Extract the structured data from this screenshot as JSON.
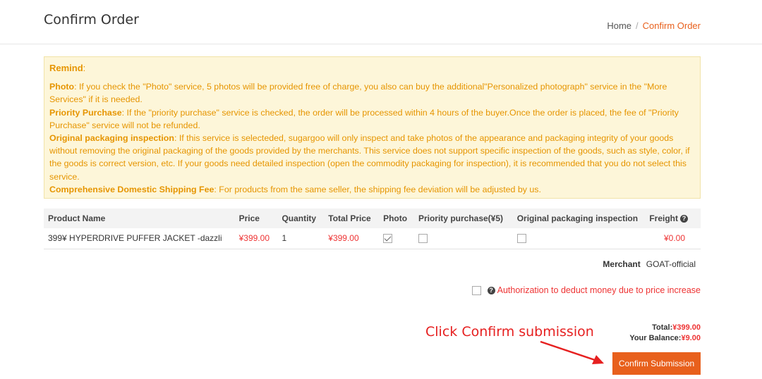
{
  "header": {
    "title": "Confirm Order",
    "breadcrumb": {
      "home": "Home",
      "separator": "/",
      "current": "Confirm Order"
    }
  },
  "remind": {
    "title": "Remind",
    "title_colon": ":",
    "photo": {
      "label": "Photo",
      "text": ": If you check the \"Photo\" service, 5 photos will be provided free of charge, you also can buy the additional\"Personalized photograph\" service in the \"More Services\" if it is needed."
    },
    "priority": {
      "label": "Priority Purchase",
      "text": ": If the \"priority purchase\" service is checked, the order will be processed within 4 hours of the buyer.Once the order is placed, the fee of \"Priority Purchase\" service will not be refunded."
    },
    "original": {
      "label": "Original packaging inspection",
      "text": ": If this service is selecteded, sugargoo will only inspect and take photos of the appearance and packaging integrity of your goods without removing the original packaging of the goods provided by the merchants. This service does not support specific inspection of the goods, such as style, color, if the goods is correct version, etc. If your goods need detailed inspection (open the commodity packaging for inspection), it is recommended that you do not select this service."
    },
    "shipping": {
      "label": "Comprehensive Domestic Shipping Fee",
      "text": ": For products from the same seller, the shipping fee deviation will be adjusted by us."
    }
  },
  "table": {
    "headers": {
      "product": "Product Name",
      "price": "Price",
      "quantity": "Quantity",
      "total": "Total Price",
      "photo": "Photo",
      "priority": "Priority purchase(¥5)",
      "original": "Original packaging inspection",
      "freight": "Freight"
    },
    "rows": [
      {
        "product": "399¥ HYPERDRIVE PUFFER JACKET -dazzli",
        "price": "¥399.00",
        "quantity": "1",
        "total": "¥399.00",
        "photo_checked": true,
        "priority_checked": false,
        "original_checked": false,
        "freight": "¥0.00"
      }
    ]
  },
  "merchant": {
    "label": "Merchant",
    "value": "GOAT-official"
  },
  "authorization": {
    "label": "Authorization to deduct money due to price increase",
    "checked": false
  },
  "totals": {
    "total_label": "Total:",
    "total_value": "¥399.00",
    "balance_label": "Your Balance:",
    "balance_value": "¥9.00"
  },
  "annotation": {
    "text": "Click Confirm submission"
  },
  "submit": {
    "label": "Confirm Submission"
  },
  "icons": {
    "help": "question-circle-icon",
    "check": "checkbox-icon",
    "arrow": "red-arrow-icon"
  },
  "colors": {
    "accent": "#e8601c",
    "price_red": "#e33333",
    "remind_text": "#e69500",
    "remind_bg": "#fdf6d9"
  }
}
